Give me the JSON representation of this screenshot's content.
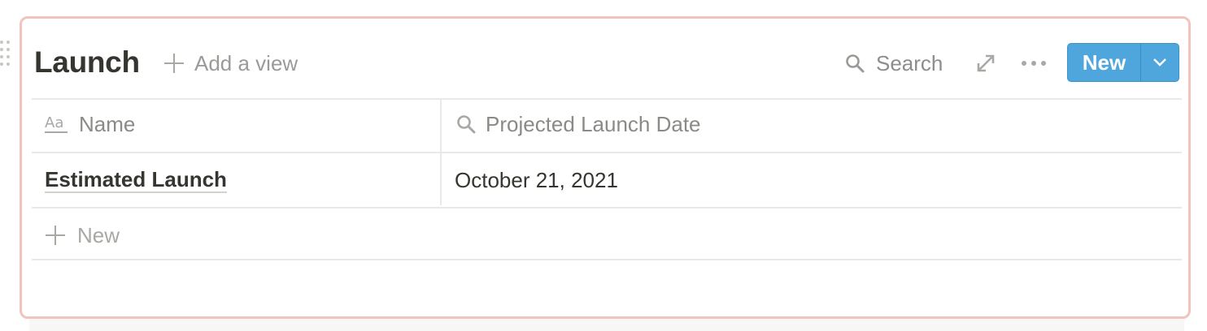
{
  "database": {
    "title": "Launch",
    "add_view_label": "Add a view",
    "search_label": "Search",
    "new_button_label": "New"
  },
  "table": {
    "columns": [
      {
        "label": "Name",
        "icon": "text-property-icon"
      },
      {
        "label": "Projected Launch Date",
        "icon": "search-icon"
      }
    ],
    "rows": [
      {
        "name": "Estimated Launch",
        "date": "October 21, 2021"
      }
    ],
    "new_row_label": "New"
  },
  "colors": {
    "accent": "#4ea6dd",
    "frame_border": "#f1c4be",
    "text_primary": "#37352f",
    "text_muted": "#9b9a97"
  }
}
